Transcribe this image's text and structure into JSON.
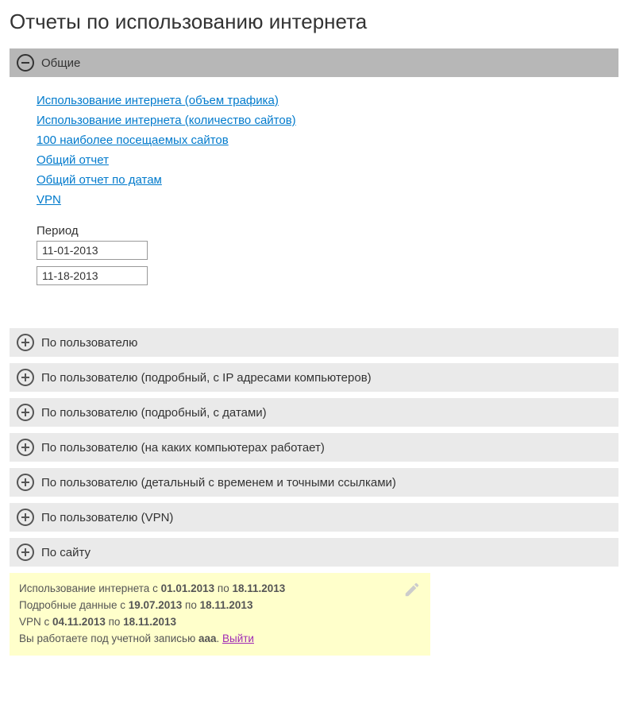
{
  "page_title": "Отчеты по использованию интернета",
  "sections": [
    {
      "title": "Общие",
      "expanded": true
    },
    {
      "title": "По пользователю",
      "expanded": false
    },
    {
      "title": "По пользователю (подробный, с IP адресами компьютеров)",
      "expanded": false
    },
    {
      "title": "По пользователю (подробный, с датами)",
      "expanded": false
    },
    {
      "title": "По пользователю (на каких компьютерах работает)",
      "expanded": false
    },
    {
      "title": "По пользователю (детальный с временем и точными ссылками)",
      "expanded": false
    },
    {
      "title": "По пользователю (VPN)",
      "expanded": false
    },
    {
      "title": "По сайту",
      "expanded": false
    }
  ],
  "general": {
    "links": [
      "Использование интернета (объем трафика)",
      "Использование интернета (количество сайтов)",
      "100 наиболее посещаемых сайтов",
      "Общий отчет",
      "Общий отчет по датам",
      "VPN"
    ],
    "period_label": "Период",
    "date_from": "11-01-2013",
    "date_to": "11-18-2013"
  },
  "info": {
    "line1_prefix": "Использование интернета с ",
    "line1_date1": "01.01.2013",
    "line1_mid": " по ",
    "line1_date2": "18.11.2013",
    "line2_prefix": "Подробные данные с ",
    "line2_date1": "19.07.2013",
    "line2_mid": " по ",
    "line2_date2": "18.11.2013",
    "line3_prefix": "VPN с ",
    "line3_date1": "04.11.2013",
    "line3_mid": " по ",
    "line3_date2": "18.11.2013",
    "line4_prefix": "Вы работаете под учетной записью ",
    "account": "aaa",
    "dot": ". ",
    "logout": "Выйти"
  }
}
